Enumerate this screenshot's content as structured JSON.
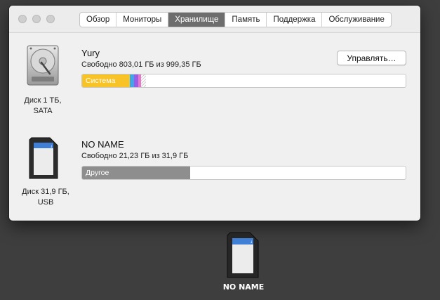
{
  "window": {
    "tabs": [
      {
        "label": "Обзор",
        "active": false
      },
      {
        "label": "Мониторы",
        "active": false
      },
      {
        "label": "Хранилище",
        "active": true
      },
      {
        "label": "Память",
        "active": false
      },
      {
        "label": "Поддержка",
        "active": false
      },
      {
        "label": "Обслуживание",
        "active": false
      }
    ]
  },
  "volumes": [
    {
      "name": "Yury",
      "free_text": "Свободно 803,01 ГБ из 999,35 ГБ",
      "device_caption": [
        "Диск 1 ТБ,",
        "SATA"
      ],
      "icon": "hard-drive-icon",
      "manage_label": "Управлять…",
      "bar": {
        "segments": [
          {
            "name": "Система",
            "fraction": 0.148,
            "color": "#f7c326"
          },
          {
            "name": "",
            "fraction": 0.012,
            "color": "#3ea7e8"
          },
          {
            "name": "",
            "fraction": 0.012,
            "color": "#9b5de5"
          },
          {
            "name": "",
            "fraction": 0.008,
            "color": "#e879c9"
          },
          {
            "name": "",
            "fraction": 0.016,
            "color": "hatched"
          }
        ]
      }
    },
    {
      "name": "NO NAME",
      "free_text": "Свободно 21,23 ГБ из 31,9 ГБ",
      "device_caption": [
        "Диск 31,9 ГБ,",
        "USB"
      ],
      "icon": "sd-card-icon",
      "bar": {
        "segments": [
          {
            "name": "Другое",
            "fraction": 0.335,
            "color": "#8e8e8e"
          }
        ]
      }
    }
  ],
  "desktop": {
    "icon": "sd-card-icon",
    "label": "NO NAME"
  }
}
